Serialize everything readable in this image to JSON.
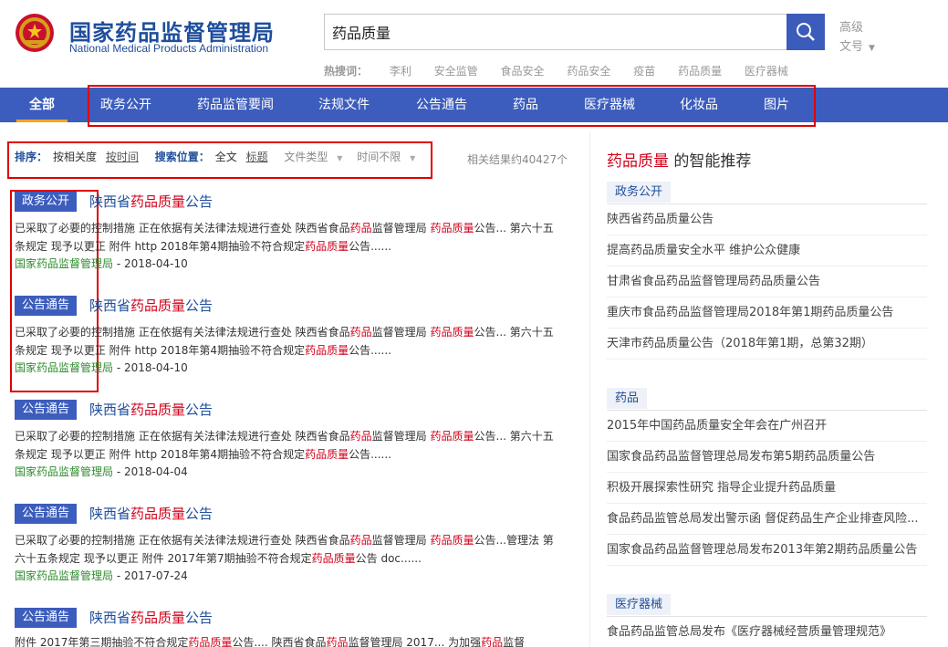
{
  "header": {
    "logo_cn": "国家药品监督管理局",
    "logo_en": "National Medical Products Administration",
    "search_value": "药品质量",
    "advanced": "高级",
    "doc_no": "文号",
    "hot_label": "热搜词：",
    "hot_items": [
      "李利",
      "安全监管",
      "食品安全",
      "药品安全",
      "疫苗",
      "药品质量",
      "医疗器械"
    ]
  },
  "nav": {
    "items": [
      "全部",
      "政务公开",
      "药品监管要闻",
      "法规文件",
      "公告通告",
      "药品",
      "医疗器械",
      "化妆品",
      "图片"
    ],
    "active": "全部"
  },
  "filter": {
    "sort_label": "排序：",
    "sort_relevance": "按相关度",
    "sort_time": "按时间",
    "pos_label": "搜索位置：",
    "pos_full": "全文",
    "pos_title": "标题",
    "file_type": "文件类型",
    "time": "时间不限",
    "result_count": "相关结果约40427个"
  },
  "results": [
    {
      "tag": "政务公开",
      "title_pre": "陕西省",
      "title_hl": "药品质量",
      "title_post": "公告",
      "snip1": "已采取了必要的控制措施 正在依据有关法律法规进行查处 陕西省食品",
      "snip_hl1": "药品",
      "snip2": "监督管理局 ",
      "snip_hl2": "药品质量",
      "snip3": "公告... 第六十五条规定 现予以更正 附件 http 2018年第4期抽验不符合规定",
      "snip_hl3": "药品质量",
      "snip4": "公告......",
      "site": "国家药品监督管理局",
      "date": " - 2018-04-10"
    },
    {
      "tag": "公告通告",
      "title_pre": "陕西省",
      "title_hl": "药品质量",
      "title_post": "公告",
      "snip1": "已采取了必要的控制措施 正在依据有关法律法规进行查处 陕西省食品",
      "snip_hl1": "药品",
      "snip2": "监督管理局 ",
      "snip_hl2": "药品质量",
      "snip3": "公告... 第六十五条规定 现予以更正 附件 http 2018年第4期抽验不符合规定",
      "snip_hl3": "药品质量",
      "snip4": "公告......",
      "site": "国家药品监督管理局",
      "date": " - 2018-04-10"
    },
    {
      "tag": "公告通告",
      "title_pre": "陕西省",
      "title_hl": "药品质量",
      "title_post": "公告",
      "snip1": "已采取了必要的控制措施 正在依据有关法律法规进行查处 陕西省食品",
      "snip_hl1": "药品",
      "snip2": "监督管理局 ",
      "snip_hl2": "药品质量",
      "snip3": "公告... 第六十五条规定 现予以更正 附件 http 2018年第4期抽验不符合规定",
      "snip_hl3": "药品质量",
      "snip4": "公告......",
      "site": "国家药品监督管理局",
      "date": " - 2018-04-04"
    },
    {
      "tag": "公告通告",
      "title_pre": "陕西省",
      "title_hl": "药品质量",
      "title_post": "公告",
      "snip1": "已采取了必要的控制措施 正在依据有关法律法规进行查处 陕西省食品",
      "snip_hl1": "药品",
      "snip2": "监督管理局 ",
      "snip_hl2": "药品质量",
      "snip3": "公告...管理法 第六十五条规定 现予以更正 附件 2017年第7期抽验不符合规定",
      "snip_hl3": "药品质量",
      "snip4": "公告 doc......",
      "site": "国家药品监督管理局",
      "date": " - 2017-07-24"
    },
    {
      "tag": "公告通告",
      "title_pre": "陕西省",
      "title_hl": "药品质量",
      "title_post": "公告",
      "snip1": "附件 2017年第三期抽验不符合规定",
      "snip_hl1": "药品质量",
      "snip2": "公告.... 陕西省食品",
      "snip_hl2": "药品",
      "snip3": "监督管理局 2017... 为加强",
      "snip_hl3": "药品",
      "snip4": "监督",
      "site": "",
      "date": ""
    }
  ],
  "sidebar": {
    "title_hl": "药品质量",
    "title_rest": " 的智能推荐",
    "sections": [
      {
        "head": "政务公开",
        "items": [
          "陕西省药品质量公告",
          "提高药品质量安全水平 维护公众健康",
          "甘肃省食品药品监督管理局药品质量公告",
          "重庆市食品药品监督管理局2018年第1期药品质量公告",
          "天津市药品质量公告（2018年第1期，总第32期）"
        ]
      },
      {
        "head": "药品",
        "items": [
          "2015年中国药品质量安全年会在广州召开",
          "国家食品药品监督管理总局发布第5期药品质量公告",
          "积极开展探索性研究 指导企业提升药品质量",
          "食品药品监管总局发出警示函 督促药品生产企业排查风险...",
          "国家食品药品监督管理总局发布2013年第2期药品质量公告"
        ]
      },
      {
        "head": "医疗器械",
        "items": [
          "食品药品监管总局发布《医疗器械经营质量管理规范》"
        ]
      }
    ]
  },
  "colors": {
    "brand_blue": "#3c5dbd",
    "highlight_red": "#d0021b",
    "source_green": "#2e8b2e",
    "annotation_red": "#e10000"
  }
}
